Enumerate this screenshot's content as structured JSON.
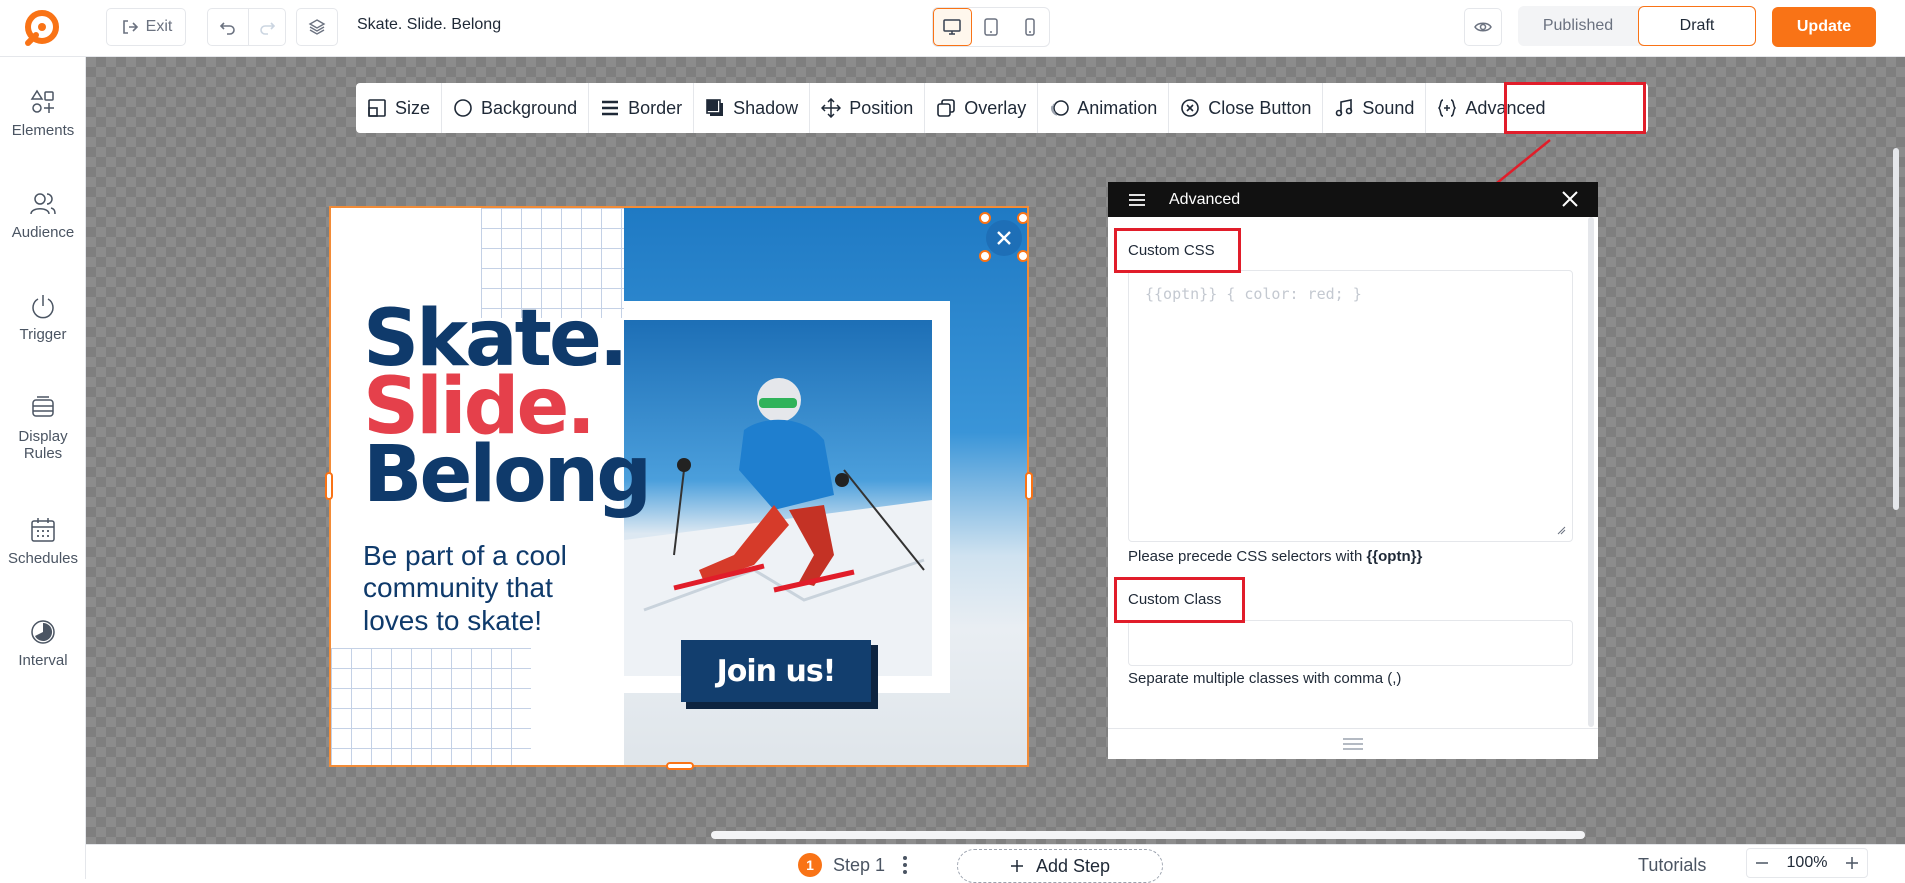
{
  "topbar": {
    "exit_label": "Exit",
    "document_title": "Skate. Slide. Belong",
    "published_label": "Published",
    "draft_label": "Draft",
    "update_label": "Update"
  },
  "sidebar": {
    "items": [
      {
        "label": "Elements",
        "icon": "elements-icon"
      },
      {
        "label": "Audience",
        "icon": "audience-icon"
      },
      {
        "label": "Trigger",
        "icon": "power-icon"
      },
      {
        "label": "Display Rules",
        "icon": "display-rules-icon"
      },
      {
        "label": "Schedules",
        "icon": "calendar-icon"
      },
      {
        "label": "Interval",
        "icon": "interval-icon"
      }
    ]
  },
  "toolbar": {
    "items": [
      "Size",
      "Background",
      "Border",
      "Shadow",
      "Position",
      "Overlay",
      "Animation",
      "Close Button",
      "Sound",
      "Advanced"
    ]
  },
  "popup": {
    "headline_1": "Skate.",
    "headline_2": "Slide.",
    "headline_3": "Belong",
    "subtitle": "Be part of a cool community that loves to skate!",
    "cta_label": "Join us!",
    "colors": {
      "navy": "#0f3a6b",
      "red": "#e5404b"
    }
  },
  "advanced_panel": {
    "title": "Advanced",
    "custom_css_label": "Custom CSS",
    "custom_css_placeholder": "{{optn}} { color: red; }",
    "css_help_prefix": "Please precede CSS selectors with ",
    "css_help_token": "{{optn}}",
    "custom_class_label": "Custom Class",
    "custom_class_value": "",
    "class_help": "Separate multiple classes with comma (,)"
  },
  "bottombar": {
    "step_number": "1",
    "step_label": "Step 1",
    "add_step_label": "Add Step",
    "tutorials_label": "Tutorials",
    "zoom_level": "100%"
  },
  "colors": {
    "accent": "#f97316",
    "highlight": "#e11d2a"
  }
}
